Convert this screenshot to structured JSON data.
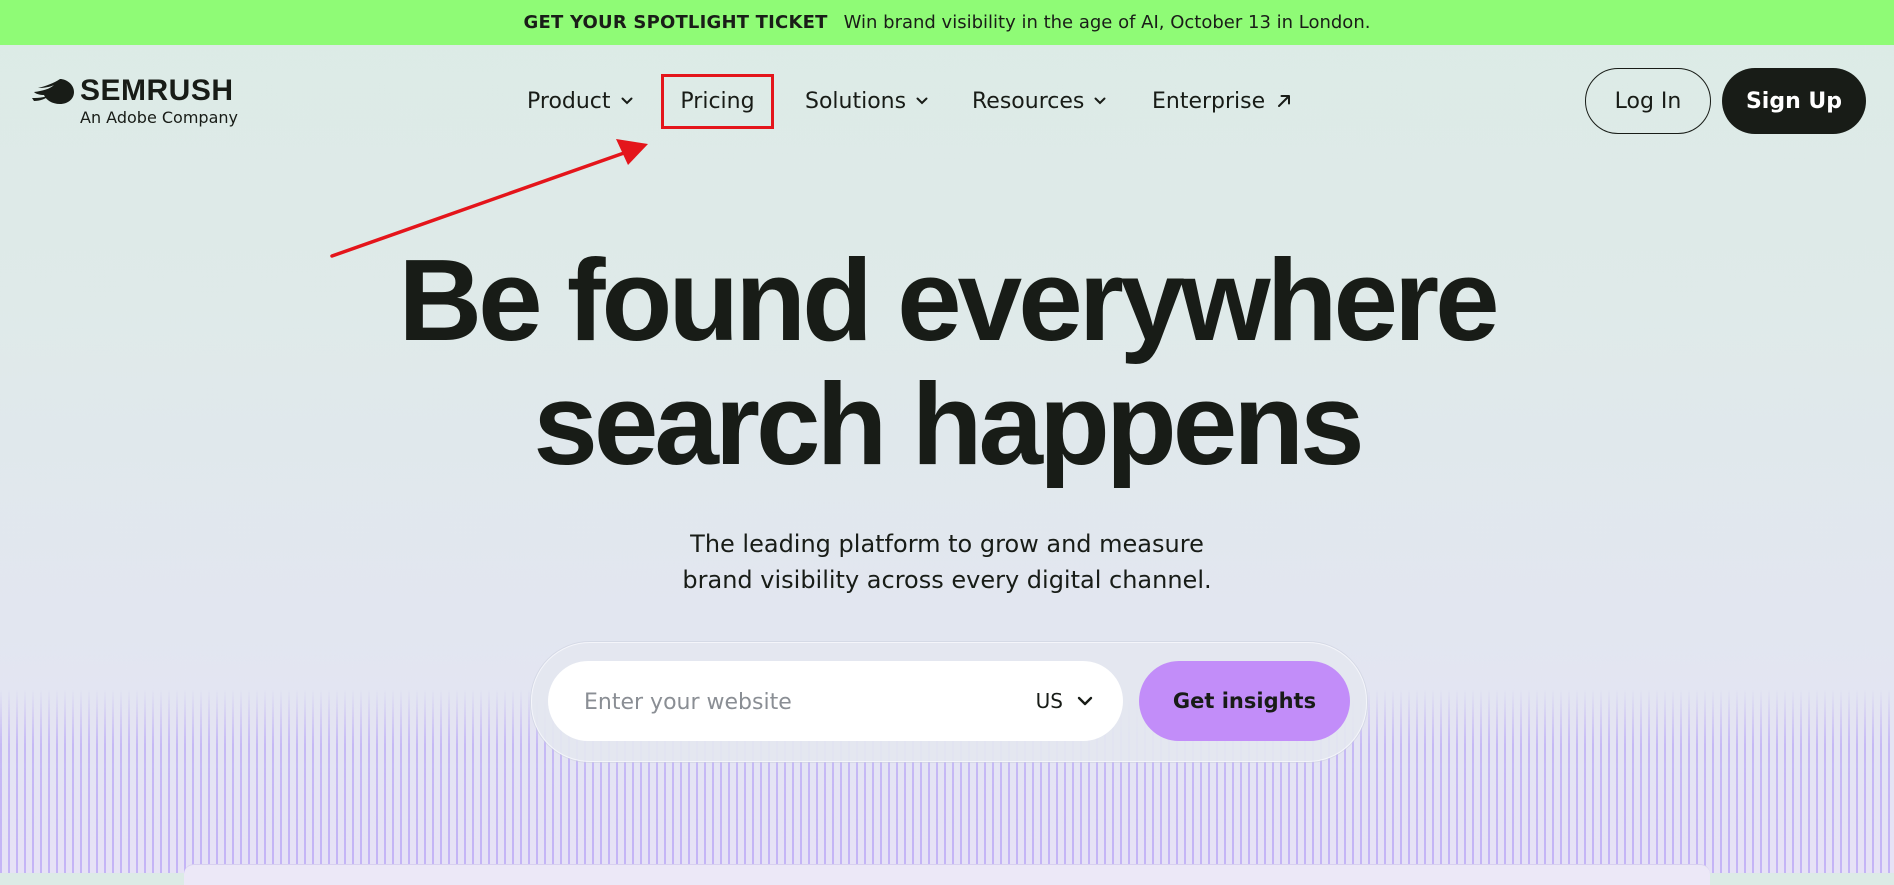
{
  "promo": {
    "headline": "GET YOUR SPOTLIGHT TICKET",
    "text": "Win brand visibility in the age of AI, October 13 in London."
  },
  "brand": {
    "name": "SEMRUSH",
    "tagline": "An Adobe Company",
    "logo_icon": "semrush-flame-icon"
  },
  "nav": {
    "product": "Product",
    "pricing": "Pricing",
    "solutions": "Solutions",
    "resources": "Resources",
    "enterprise": "Enterprise",
    "dropdown_icon": "chevron-down-icon",
    "external_icon": "arrow-up-right-icon"
  },
  "auth": {
    "login_label": "Log In",
    "signup_label": "Sign Up"
  },
  "hero": {
    "title_line1": "Be found everywhere",
    "title_line2": "search happens",
    "subtitle_line1": "The leading platform to grow and measure",
    "subtitle_line2": "brand visibility across every digital channel."
  },
  "search": {
    "placeholder": "Enter your website",
    "value": "",
    "country": "US",
    "submit_label": "Get insights"
  },
  "colors": {
    "promo_bg": "#8ffb76",
    "text_dark": "#181c17",
    "accent_purple": "#c28df9",
    "annotation_red": "#e4151b"
  }
}
